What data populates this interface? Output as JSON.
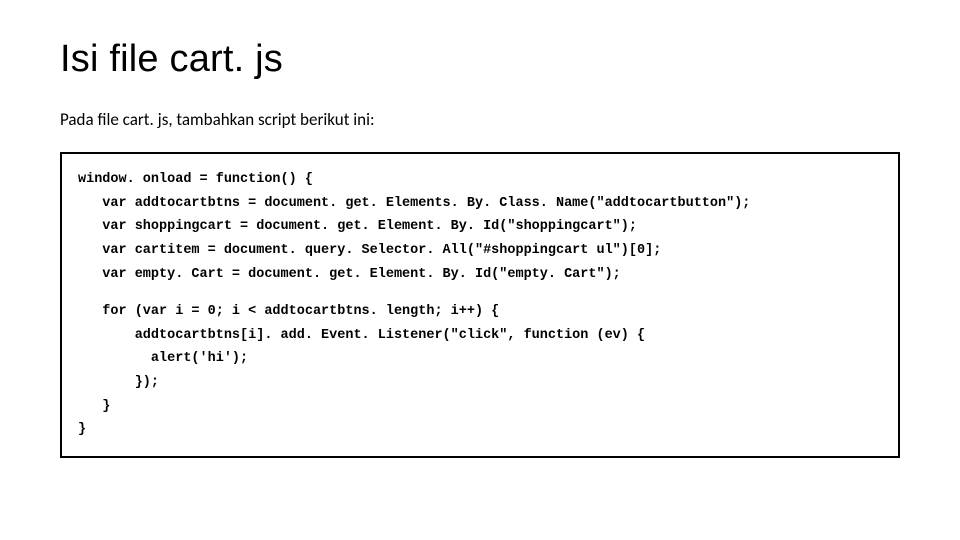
{
  "title": "Isi file cart. js",
  "subtitle": "Pada file cart. js, tambahkan script berikut ini:",
  "code": {
    "l1": "window. onload = function() {",
    "l2": "   var addtocartbtns = document. get. Elements. By. Class. Name(\"addtocartbutton\");",
    "l3": "   var shoppingcart = document. get. Element. By. Id(\"shoppingcart\");",
    "l4": "   var cartitem = document. query. Selector. All(\"#shoppingcart ul\")[0];",
    "l5": "   var empty. Cart = document. get. Element. By. Id(\"empty. Cart\");",
    "l6": "   for (var i = 0; i < addtocartbtns. length; i++) {",
    "l7": "       addtocartbtns[i]. add. Event. Listener(\"click\", function (ev) {",
    "l8": "         alert('hi');",
    "l9": "       });",
    "l10": "   }",
    "l11": "}"
  }
}
